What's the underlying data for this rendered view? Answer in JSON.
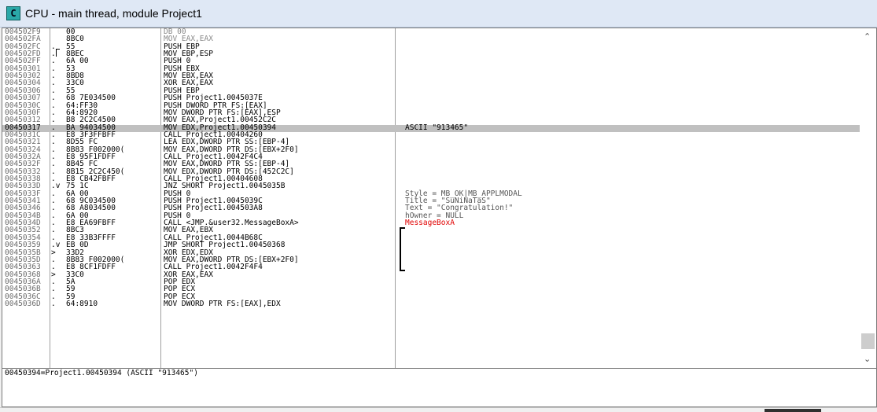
{
  "window": {
    "title": "CPU - main thread, module Project1",
    "icon_letter": "C"
  },
  "rows": [
    {
      "addr": "004502F9",
      "mk": "",
      "hex": "00",
      "dis": "DB 00",
      "cmt": "",
      "dim": true
    },
    {
      "addr": "004502FA",
      "mk": "",
      "hex": "8BC0",
      "dis": "MOV EAX,EAX",
      "cmt": "",
      "dim": true
    },
    {
      "addr": "004502FC",
      "mk": ".",
      "hex": "55",
      "dis": "PUSH EBP",
      "cmt": ""
    },
    {
      "addr": "004502FD",
      "mk": ".",
      "hex": "8BEC",
      "dis": "MOV EBP,ESP",
      "cmt": ""
    },
    {
      "addr": "004502FF",
      "mk": ".",
      "hex": "6A 00",
      "dis": "PUSH 0",
      "cmt": ""
    },
    {
      "addr": "00450301",
      "mk": ".",
      "hex": "53",
      "dis": "PUSH EBX",
      "cmt": ""
    },
    {
      "addr": "00450302",
      "mk": ".",
      "hex": "8BD8",
      "dis": "MOV EBX,EAX",
      "cmt": ""
    },
    {
      "addr": "00450304",
      "mk": ".",
      "hex": "33C0",
      "dis": "XOR EAX,EAX",
      "cmt": ""
    },
    {
      "addr": "00450306",
      "mk": ".",
      "hex": "55",
      "dis": "PUSH EBP",
      "cmt": ""
    },
    {
      "addr": "00450307",
      "mk": ".",
      "hex": "68 7E034500",
      "dis": "PUSH Project1.0045037E",
      "cmt": ""
    },
    {
      "addr": "0045030C",
      "mk": ".",
      "hex": "64:FF30",
      "dis": "PUSH DWORD PTR FS:[EAX]",
      "cmt": ""
    },
    {
      "addr": "0045030F",
      "mk": ".",
      "hex": "64:8920",
      "dis": "MOV DWORD PTR FS:[EAX],ESP",
      "cmt": ""
    },
    {
      "addr": "00450312",
      "mk": ".",
      "hex": "B8 2C2C4500",
      "dis": "MOV EAX,Project1.00452C2C",
      "cmt": ""
    },
    {
      "addr": "00450317",
      "mk": ".",
      "hex": "BA 94034500",
      "dis": "MOV EDX,Project1.00450394",
      "cmt": "ASCII \"913465\"",
      "sel": true
    },
    {
      "addr": "0045031C",
      "mk": ".",
      "hex": "E8 3F3FFBFF",
      "dis": "CALL Project1.00404260",
      "cmt": ""
    },
    {
      "addr": "00450321",
      "mk": ".",
      "hex": "8D55 FC",
      "dis": "LEA EDX,DWORD PTR SS:[EBP-4]",
      "cmt": ""
    },
    {
      "addr": "00450324",
      "mk": ".",
      "hex": "8B83 F002000(",
      "dis": "MOV EAX,DWORD PTR DS:[EBX+2F0]",
      "cmt": ""
    },
    {
      "addr": "0045032A",
      "mk": ".",
      "hex": "E8 95F1FDFF",
      "dis": "CALL Project1.0042F4C4",
      "cmt": ""
    },
    {
      "addr": "0045032F",
      "mk": ".",
      "hex": "8B45 FC",
      "dis": "MOV EAX,DWORD PTR SS:[EBP-4]",
      "cmt": ""
    },
    {
      "addr": "00450332",
      "mk": ".",
      "hex": "8B15 2C2C450(",
      "dis": "MOV EDX,DWORD PTR DS:[452C2C]",
      "cmt": ""
    },
    {
      "addr": "00450338",
      "mk": ".",
      "hex": "E8 CB42FBFF",
      "dis": "CALL Project1.00404608",
      "cmt": ""
    },
    {
      "addr": "0045033D",
      "mk": ".v",
      "hex": "75 1C",
      "dis": "JNZ SHORT Project1.0045035B",
      "cmt": ""
    },
    {
      "addr": "0045033F",
      "mk": ".",
      "hex": "6A 00",
      "dis": "PUSH 0",
      "cmt": "Style = MB_OK|MB_APPLMODAL",
      "grey": true
    },
    {
      "addr": "00450341",
      "mk": ".",
      "hex": "68 9C034500",
      "dis": "PUSH Project1.0045039C",
      "cmt": "Title = \"SuNiNaTaS\"",
      "grey": true
    },
    {
      "addr": "00450346",
      "mk": ".",
      "hex": "68 A8034500",
      "dis": "PUSH Project1.004503A8",
      "cmt": "Text = \"Congratulation!\"",
      "grey": true
    },
    {
      "addr": "0045034B",
      "mk": ".",
      "hex": "6A 00",
      "dis": "PUSH 0",
      "cmt": "hOwner = NULL",
      "grey": true
    },
    {
      "addr": "0045034D",
      "mk": ".",
      "hex": "E8 EA69FBFF",
      "dis": "CALL <JMP.&user32.MessageBoxA>",
      "cmt": "MessageBoxA",
      "red": true
    },
    {
      "addr": "00450352",
      "mk": ".",
      "hex": "8BC3",
      "dis": "MOV EAX,EBX",
      "cmt": ""
    },
    {
      "addr": "00450354",
      "mk": ".",
      "hex": "E8 33B3FFFF",
      "dis": "CALL Project1.0044B68C",
      "cmt": ""
    },
    {
      "addr": "00450359",
      "mk": ".v",
      "hex": "EB 0D",
      "dis": "JMP SHORT Project1.00450368",
      "cmt": ""
    },
    {
      "addr": "0045035B",
      "mk": ">",
      "hex": "33D2",
      "dis": "XOR EDX,EDX",
      "cmt": ""
    },
    {
      "addr": "0045035D",
      "mk": ".",
      "hex": "8B83 F002000(",
      "dis": "MOV EAX,DWORD PTR DS:[EBX+2F0]",
      "cmt": ""
    },
    {
      "addr": "00450363",
      "mk": ".",
      "hex": "E8 8CF1FDFF",
      "dis": "CALL Project1.0042F4F4",
      "cmt": ""
    },
    {
      "addr": "00450368",
      "mk": ">",
      "hex": "33C0",
      "dis": "XOR EAX,EAX",
      "cmt": ""
    },
    {
      "addr": "0045036A",
      "mk": ".",
      "hex": "5A",
      "dis": "POP EDX",
      "cmt": ""
    },
    {
      "addr": "0045036B",
      "mk": ".",
      "hex": "59",
      "dis": "POP ECX",
      "cmt": ""
    },
    {
      "addr": "0045036C",
      "mk": ".",
      "hex": "59",
      "dis": "POP ECX",
      "cmt": ""
    },
    {
      "addr": "0045036D",
      "mk": ".",
      "hex": "64:8910",
      "dis": "MOV DWORD PTR FS:[EAX],EDX",
      "cmt": ""
    }
  ],
  "info_text": "00450394=Project1.00450394 (ASCII \"913465\")",
  "scrollbar": {
    "up_icon": "scroll-up-icon",
    "down_icon": "scroll-down-icon",
    "thumb_position_fraction": 0.92
  },
  "colors": {
    "selected_row": "#c0c0c0",
    "api_call_comment": "#e00000",
    "titlebar": "#dfe8f5"
  }
}
